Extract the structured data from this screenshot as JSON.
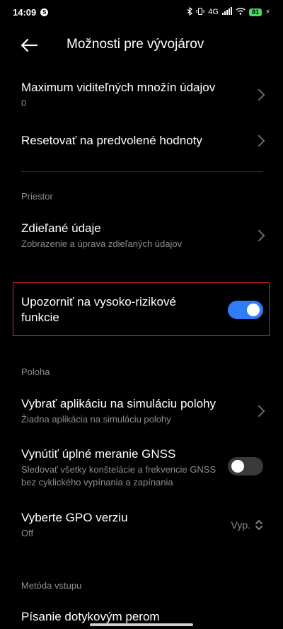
{
  "status_bar": {
    "time": "14:09",
    "app_badge": "S",
    "network": "4G",
    "battery": "81"
  },
  "header": {
    "title": "Možnosti pre vývojárov"
  },
  "rows": {
    "max_datasets": {
      "title": "Maximum viditeľných množín údajov",
      "value": "0"
    },
    "reset_defaults": {
      "title": "Resetovať na predvolené hodnoty"
    }
  },
  "sections": {
    "space": "Priestor",
    "location": "Poloha",
    "input": "Metóda vstupu"
  },
  "shared_data": {
    "title": "Zdieľané údaje",
    "subtitle": "Zobrazenie a úprava zdieľaných údajov"
  },
  "high_risk": {
    "title": "Upozorniť na vysoko-rizikové funkcie",
    "enabled": true
  },
  "mock_location": {
    "title": "Vybrať aplikáciu na simuláciu polohy",
    "subtitle": "Žiadna aplikácia na simuláciu polohy"
  },
  "gnss": {
    "title": "Vynútiť úplné meranie GNSS",
    "subtitle": "Sledovať všetky konštelácie a frekvencie GNSS bez cyklického vypínania a zapínania",
    "enabled": false
  },
  "gpo": {
    "title": "Vyberte GPO verziu",
    "subtitle": "Off",
    "value": "Vyp."
  },
  "stylus": {
    "title": "Písanie dotykovým perom"
  },
  "colors": {
    "accent": "#2f7cf6",
    "highlight_border": "#d8232a",
    "secondary_text": "#8d8d8d"
  }
}
